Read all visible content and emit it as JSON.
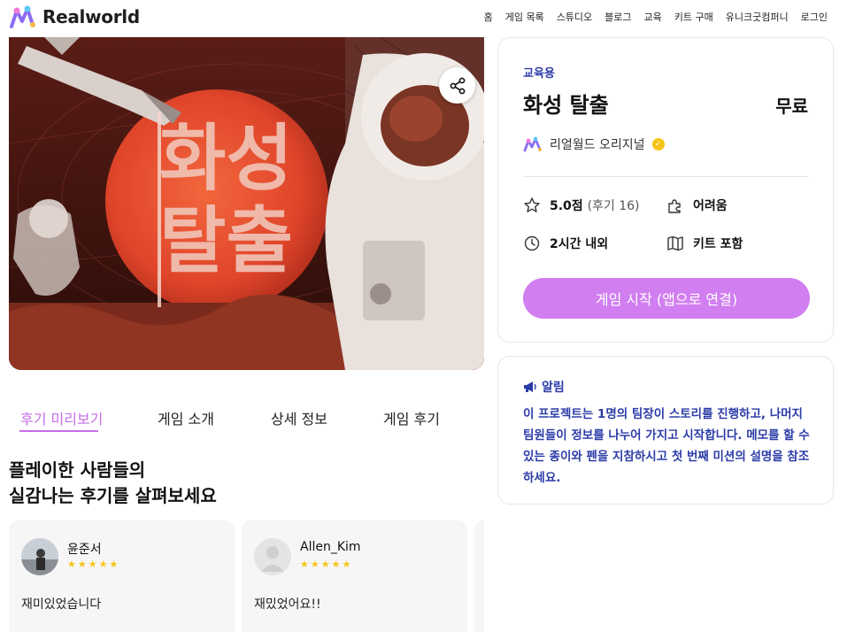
{
  "header": {
    "logo_text": "Realworld",
    "nav": [
      "홈",
      "게임 목록",
      "스튜디오",
      "블로그",
      "교육",
      "키트 구매",
      "유니크굿컴퍼니",
      "로그인"
    ]
  },
  "hero": {
    "title_art_line1": "화성",
    "title_art_line2": "탈출",
    "share_icon": "share-icon"
  },
  "tabs": [
    {
      "label": "후기 미리보기",
      "active": true
    },
    {
      "label": "게임 소개",
      "active": false
    },
    {
      "label": "상세 정보",
      "active": false
    },
    {
      "label": "게임 후기",
      "active": false
    }
  ],
  "reviews_section": {
    "heading_line1": "플레이한 사람들의",
    "heading_line2": "실감나는 후기를 살펴보세요",
    "reviews": [
      {
        "name": "윤준서",
        "stars": "★★★★★",
        "text": "재미있었습니다"
      },
      {
        "name": "Allen_Kim",
        "stars": "★★★★★",
        "text": "재밌었어요!!"
      }
    ]
  },
  "info": {
    "category": "교육용",
    "title": "화성 탈출",
    "price": "무료",
    "creator": "리얼월드 오리지널",
    "rating": "5.0점",
    "review_count": "(후기 16)",
    "difficulty": "어려움",
    "duration": "2시간 내외",
    "kit": "키트 포함",
    "cta": "게임 시작 (앱으로 연결)"
  },
  "notice": {
    "title": "알림",
    "body": "이 프로젝트는 1명의 팀장이 스토리를 진행하고, 나머지 팀원들이 정보를 나누어 가지고 시작합니다. 메모를 할 수 있는 종이와 펜을 지참하시고 첫 번째 미션의 설명을 참조하세요."
  },
  "colors": {
    "accent": "#c56ee8",
    "cta": "#d17ef0",
    "notice_blue": "#2c3ca8",
    "star": "#f5c518"
  }
}
